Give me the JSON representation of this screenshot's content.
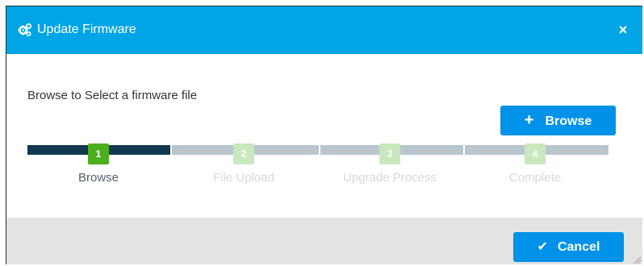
{
  "dialog": {
    "title": "Update Firmware",
    "header_icon": "gears-icon",
    "close_label": "×",
    "prompt": "Browse to Select a firmware file",
    "browse_button": {
      "icon": "plus-icon",
      "icon_glyph": "+",
      "label": "Browse"
    },
    "steps": [
      {
        "number": "1",
        "label": "Browse",
        "state": "active"
      },
      {
        "number": "2",
        "label": "File Upload",
        "state": "pending"
      },
      {
        "number": "3",
        "label": "Upgrade Process",
        "state": "pending"
      },
      {
        "number": "4",
        "label": "Complete",
        "state": "pending"
      }
    ],
    "progress_completed_steps": 1,
    "cancel_button": {
      "icon": "check-icon",
      "icon_glyph": "✔",
      "label": "Cancel"
    }
  },
  "colors": {
    "header": "#00a5e6",
    "button": "#0092e8",
    "progress_done": "#10394f",
    "progress_pending": "#b9c6ce",
    "step_active": "#4caf1e",
    "step_pending": "#c8e8bd",
    "footer": "#e3e3e3"
  }
}
